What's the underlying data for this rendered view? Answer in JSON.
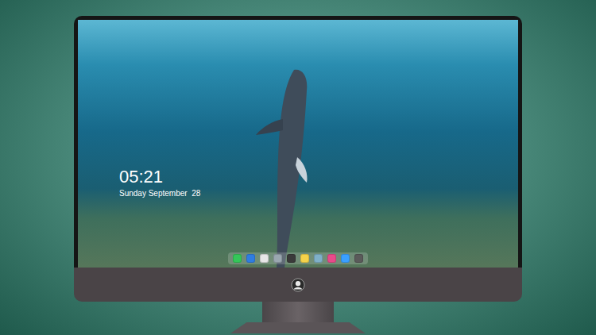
{
  "lock_screen": {
    "time": "05:21",
    "date": "Sunday September  28"
  },
  "dock": {
    "apps": [
      {
        "color": "#34c759"
      },
      {
        "color": "#2f7de1"
      },
      {
        "color": "#e6e6e6"
      },
      {
        "color": "#9aa7b0"
      },
      {
        "color": "#3a3a3a"
      },
      {
        "color": "#f5d24a"
      },
      {
        "color": "#7fb0c8"
      },
      {
        "color": "#e84a8a"
      },
      {
        "color": "#3aa0ff"
      },
      {
        "color": "#5a5a5a"
      }
    ]
  }
}
